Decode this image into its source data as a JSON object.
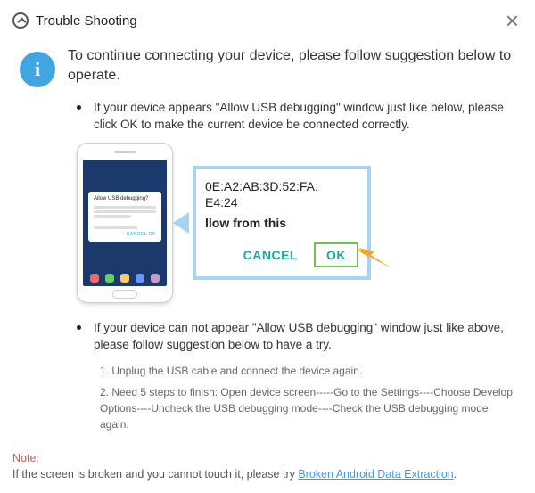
{
  "titlebar": {
    "title": "Trouble Shooting"
  },
  "info_glyph": "i",
  "heading": "To continue connecting your device, please follow suggestion below to operate.",
  "bullet1": "If your device appears \"Allow USB debugging\" window just like below, please click OK to make the current device  be connected correctly.",
  "phone_popup": {
    "title": "Allow USB debugging?",
    "btns": "CANCEL   OK"
  },
  "zoom": {
    "mac_line1": "0E:A2:AB:3D:52:FA:",
    "mac_line2": "E4:24",
    "sub": "llow from this",
    "cancel": "CANCEL",
    "ok": "OK"
  },
  "bullet2": "If your device can not appear \"Allow USB debugging\" window just like above, please follow suggestion below to have a try.",
  "steps": {
    "s1": "1. Unplug the USB cable and connect the device again.",
    "s2": "2. Need 5 steps to finish: Open device screen-----Go to the Settings----Choose Develop Options----Uncheck the USB debugging mode----Check the USB debugging mode again."
  },
  "note": {
    "label": "Note:",
    "text_before": "If the screen is broken and you cannot touch it, please try ",
    "link": "Broken Android Data Extraction",
    "text_after": "."
  }
}
